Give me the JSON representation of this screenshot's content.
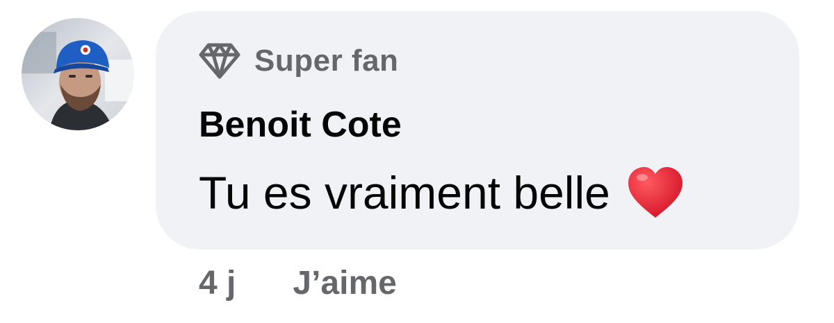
{
  "comment": {
    "badge": {
      "icon": "diamond-icon",
      "label": "Super fan"
    },
    "author": "Benoit Cote",
    "text": "Tu es vraiment belle",
    "emoji": "red-heart-icon",
    "time_ago": "4 j",
    "like_label": "J’aime"
  },
  "colors": {
    "bubble_background": "#f0f2f5",
    "secondary_text": "#65676b",
    "primary_text": "#050505",
    "heart": "#e0182d"
  }
}
